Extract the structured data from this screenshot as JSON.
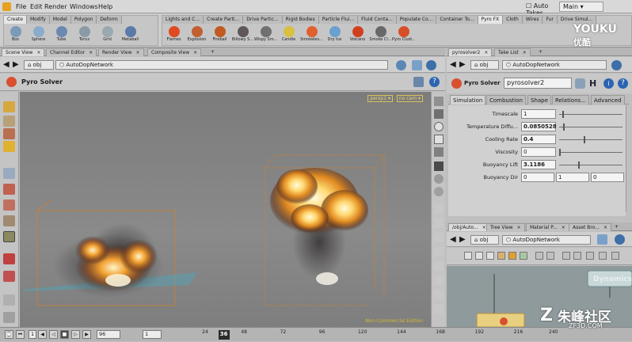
{
  "menubar": {
    "items": [
      "File",
      "Edit",
      "Render",
      "Windows",
      "Help"
    ],
    "auto_takes": "Auto Takes",
    "desktop": "Main"
  },
  "shelf_left": {
    "tabs": [
      "Create",
      "Modify",
      "Model",
      "Polygon",
      "Deform"
    ],
    "tools": [
      "Box",
      "Sphere",
      "Tube",
      "Torus",
      "Grid",
      "Metaball"
    ]
  },
  "shelf_right": {
    "tabs": [
      "Lights and C...",
      "Create Parti...",
      "Drive Partic...",
      "Rigid Bodies",
      "Particle Flui...",
      "Fluid Conta...",
      "Populate Co...",
      "Container To...",
      "Pyro FX",
      "Cloth",
      "Wires",
      "Fur",
      "Drive Simul..."
    ],
    "tools": [
      "Flames",
      "Explosion",
      "Fireball",
      "Billowy S...",
      "Wispy Sm...",
      "Candle",
      "Smokeles...",
      "Dry Ice",
      "Volcano",
      "Smoke Cl...",
      "Pyro Clust..."
    ]
  },
  "watermark_top": {
    "brand": "YOUKU",
    "sub": "优酷"
  },
  "left_pane": {
    "tabs": [
      "Scene View",
      "Channel Editor",
      "Render View",
      "Composite View"
    ],
    "path_root": "obj",
    "path_node": "AutoDopNetwork",
    "title": "Pyro Solver",
    "camera_labels": [
      "persp1 ▾",
      "no cam ▾"
    ],
    "watermark": "Non-Commercial Edition"
  },
  "right_pane": {
    "tabs": [
      "pyrosolver2",
      "Take List"
    ],
    "path_root": "obj",
    "path_node": "AutoDopNetwork",
    "node_type": "Pyro Solver",
    "node_name": "pyrosolver2",
    "parm_tabs": [
      "Simulation",
      "Combustion",
      "Shape",
      "Relations...",
      "Advanced"
    ],
    "params": [
      {
        "label": "Timescale",
        "value": "1",
        "slider": 0.05
      },
      {
        "label": "Temperature Diffu...",
        "value": "0.0850528",
        "slider": 0.06
      },
      {
        "label": "Cooling Rate",
        "value": "0.4",
        "slider": 0.4
      },
      {
        "label": "Viscosity",
        "value": "0",
        "slider": 0.0
      },
      {
        "label": "Buoyancy Lift",
        "value": "3.1186",
        "slider": 0.31
      }
    ],
    "buoyancy_dir": {
      "label": "Buoyancy Dir",
      "values": [
        "0",
        "1",
        "0"
      ]
    }
  },
  "network_pane": {
    "tabs": [
      "/obj/Auto...",
      "Tree View",
      "Material P...",
      "Asset Bro..."
    ],
    "path_root": "obj",
    "path_node": "AutoDopNetwork",
    "node_label": "Dynamics"
  },
  "timeline": {
    "start": "1",
    "start_box": "96",
    "end_box": "1",
    "current_frame": "36",
    "ticks": [
      "24",
      "48",
      "72",
      "96",
      "120",
      "144",
      "168",
      "192",
      "216",
      "240"
    ],
    "end_frame": "240"
  },
  "watermark_bottom": {
    "brand": "朱峰社区",
    "url": "ZF3D.COM"
  }
}
